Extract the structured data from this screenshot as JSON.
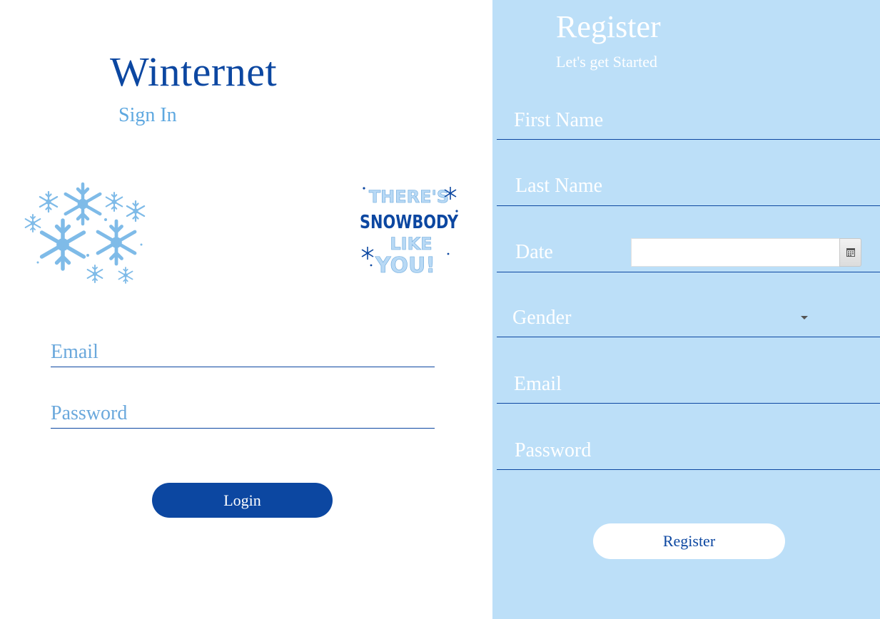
{
  "login": {
    "brand": "Winternet",
    "subtitle": "Sign In",
    "email_label": "Email",
    "password_label": "Password",
    "login_button": "Login",
    "sticker_lines": [
      "THERE'S",
      "SNOWBODY",
      "LIKE",
      "YOU!"
    ]
  },
  "register": {
    "title": "Register",
    "subtitle": "Let's get Started",
    "first_name_label": "First Name",
    "last_name_label": "Last Name",
    "date_label": "Date",
    "date_value": "",
    "gender_label": "Gender",
    "email_label": "Email",
    "password_label": "Password",
    "register_button": "Register"
  },
  "colors": {
    "brand_blue": "#0c47a1",
    "light_blue": "#5ea8e0",
    "panel_bg": "#bcdff8",
    "white": "#ffffff"
  },
  "icons": [
    "snowflake-cluster-icon",
    "calendar-icon",
    "dropdown-caret-icon"
  ]
}
